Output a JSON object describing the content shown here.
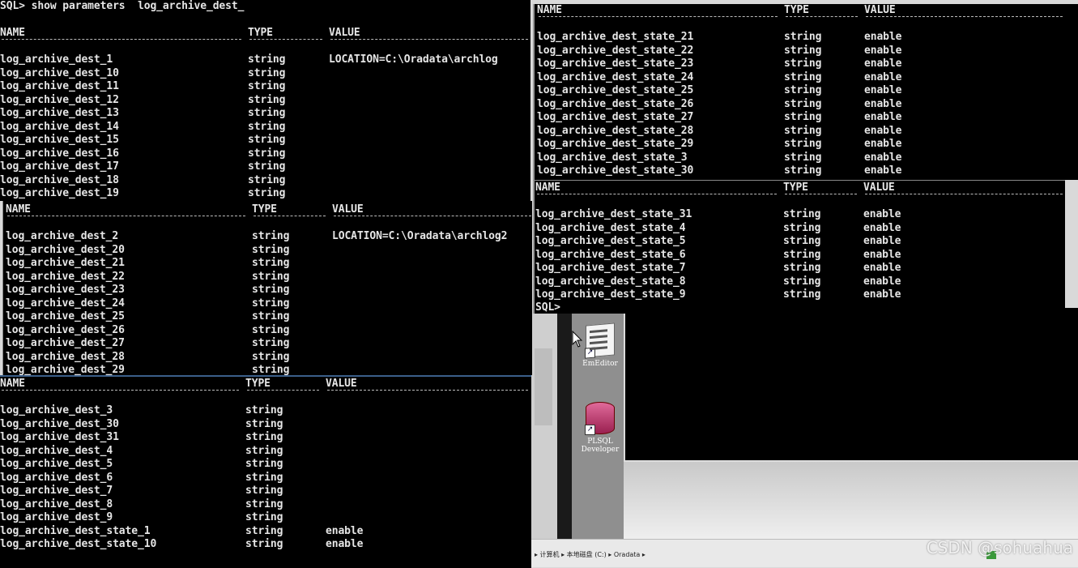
{
  "panel1": {
    "command": "SQL> show parameters  log_archive_dest_",
    "headers": {
      "name": "NAME",
      "type": "TYPE",
      "value": "VALUE"
    },
    "rows": [
      {
        "name": "log_archive_dest_1",
        "type": "string",
        "value": "LOCATION=C:\\Oradata\\archlog"
      },
      {
        "name": "log_archive_dest_10",
        "type": "string",
        "value": ""
      },
      {
        "name": "log_archive_dest_11",
        "type": "string",
        "value": ""
      },
      {
        "name": "log_archive_dest_12",
        "type": "string",
        "value": ""
      },
      {
        "name": "log_archive_dest_13",
        "type": "string",
        "value": ""
      },
      {
        "name": "log_archive_dest_14",
        "type": "string",
        "value": ""
      },
      {
        "name": "log_archive_dest_15",
        "type": "string",
        "value": ""
      },
      {
        "name": "log_archive_dest_16",
        "type": "string",
        "value": ""
      },
      {
        "name": "log_archive_dest_17",
        "type": "string",
        "value": ""
      },
      {
        "name": "log_archive_dest_18",
        "type": "string",
        "value": ""
      },
      {
        "name": "log_archive_dest_19",
        "type": "string",
        "value": ""
      }
    ]
  },
  "panel2": {
    "headers": {
      "name": "NAME",
      "type": "TYPE",
      "value": "VALUE"
    },
    "rows": [
      {
        "name": "log_archive_dest_2",
        "type": "string",
        "value": "LOCATION=C:\\Oradata\\archlog2"
      },
      {
        "name": "log_archive_dest_20",
        "type": "string",
        "value": ""
      },
      {
        "name": "log_archive_dest_21",
        "type": "string",
        "value": ""
      },
      {
        "name": "log_archive_dest_22",
        "type": "string",
        "value": ""
      },
      {
        "name": "log_archive_dest_23",
        "type": "string",
        "value": ""
      },
      {
        "name": "log_archive_dest_24",
        "type": "string",
        "value": ""
      },
      {
        "name": "log_archive_dest_25",
        "type": "string",
        "value": ""
      },
      {
        "name": "log_archive_dest_26",
        "type": "string",
        "value": ""
      },
      {
        "name": "log_archive_dest_27",
        "type": "string",
        "value": ""
      },
      {
        "name": "log_archive_dest_28",
        "type": "string",
        "value": ""
      },
      {
        "name": "log_archive_dest_29",
        "type": "string",
        "value": ""
      }
    ]
  },
  "panel3": {
    "headers": {
      "name": "NAME",
      "type": "TYPE",
      "value": "VALUE"
    },
    "rows": [
      {
        "name": "log_archive_dest_3",
        "type": "string",
        "value": ""
      },
      {
        "name": "log_archive_dest_30",
        "type": "string",
        "value": ""
      },
      {
        "name": "log_archive_dest_31",
        "type": "string",
        "value": ""
      },
      {
        "name": "log_archive_dest_4",
        "type": "string",
        "value": ""
      },
      {
        "name": "log_archive_dest_5",
        "type": "string",
        "value": ""
      },
      {
        "name": "log_archive_dest_6",
        "type": "string",
        "value": ""
      },
      {
        "name": "log_archive_dest_7",
        "type": "string",
        "value": ""
      },
      {
        "name": "log_archive_dest_8",
        "type": "string",
        "value": ""
      },
      {
        "name": "log_archive_dest_9",
        "type": "string",
        "value": ""
      },
      {
        "name": "log_archive_dest_state_1",
        "type": "string",
        "value": "enable"
      },
      {
        "name": "log_archive_dest_state_10",
        "type": "string",
        "value": "enable"
      }
    ]
  },
  "panel4": {
    "headers": {
      "name": "NAME",
      "type": "TYPE",
      "value": "VALUE"
    },
    "rows": [
      {
        "name": "log_archive_dest_state_21",
        "type": "string",
        "value": "enable"
      },
      {
        "name": "log_archive_dest_state_22",
        "type": "string",
        "value": "enable"
      },
      {
        "name": "log_archive_dest_state_23",
        "type": "string",
        "value": "enable"
      },
      {
        "name": "log_archive_dest_state_24",
        "type": "string",
        "value": "enable"
      },
      {
        "name": "log_archive_dest_state_25",
        "type": "string",
        "value": "enable"
      },
      {
        "name": "log_archive_dest_state_26",
        "type": "string",
        "value": "enable"
      },
      {
        "name": "log_archive_dest_state_27",
        "type": "string",
        "value": "enable"
      },
      {
        "name": "log_archive_dest_state_28",
        "type": "string",
        "value": "enable"
      },
      {
        "name": "log_archive_dest_state_29",
        "type": "string",
        "value": "enable"
      },
      {
        "name": "log_archive_dest_state_3",
        "type": "string",
        "value": "enable"
      },
      {
        "name": "log_archive_dest_state_30",
        "type": "string",
        "value": "enable"
      }
    ]
  },
  "panel5": {
    "headers": {
      "name": "NAME",
      "type": "TYPE",
      "value": "VALUE"
    },
    "rows": [
      {
        "name": "log_archive_dest_state_31",
        "type": "string",
        "value": "enable"
      },
      {
        "name": "log_archive_dest_state_4",
        "type": "string",
        "value": "enable"
      },
      {
        "name": "log_archive_dest_state_5",
        "type": "string",
        "value": "enable"
      },
      {
        "name": "log_archive_dest_state_6",
        "type": "string",
        "value": "enable"
      },
      {
        "name": "log_archive_dest_state_7",
        "type": "string",
        "value": "enable"
      },
      {
        "name": "log_archive_dest_state_8",
        "type": "string",
        "value": "enable"
      },
      {
        "name": "log_archive_dest_state_9",
        "type": "string",
        "value": "enable"
      }
    ],
    "prompt": "SQL>"
  },
  "desktop": {
    "icons": [
      {
        "label": "EmEditor",
        "icon": "emeditor-icon"
      },
      {
        "label": "PLSQL Developer",
        "icon": "database-icon"
      }
    ],
    "statusbar_path": "▸ 计算机 ▸ 本地磁盘 (C:) ▸ Oradata ▸",
    "watermark": "CSDN @sohuahua"
  }
}
